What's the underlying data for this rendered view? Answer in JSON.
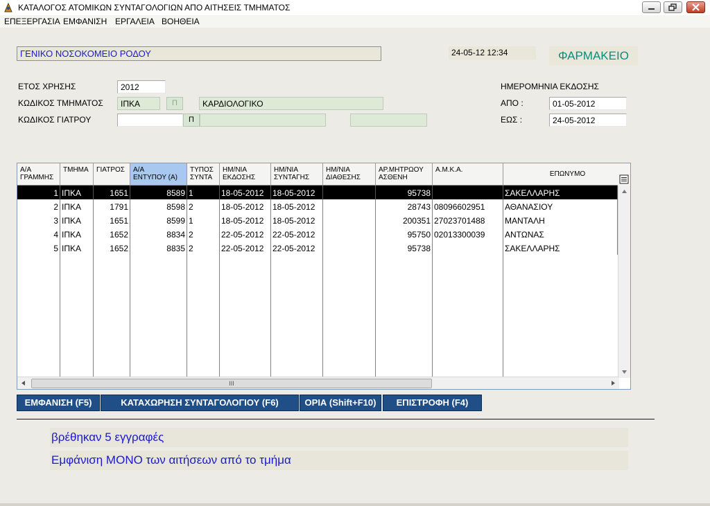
{
  "window": {
    "title": "ΚΑΤΑΛΟΓΟΣ  ΑΤΟΜΙΚΩΝ ΣΥΝΤΑΓΟΛΟΓΙΩΝ ΑΠΟ ΑΙΤΗΣΕΙΣ ΤΜΗΜΑΤΟΣ"
  },
  "menu": [
    "ΕΠΕΞΕΡΓΑΣΙΑ",
    "ΕΜΦΑΝΙΣΗ",
    "ΕΡΓΑΛΕΙΑ",
    "ΒΟΗΘΕΙΑ"
  ],
  "header": {
    "hospital": "ΓΕΝΙΚΟ ΝΟΣΟΚΟΜΕΙΟ ΡΟΔΟΥ",
    "datetime": "24-05-12 12:34",
    "pharmacy": "ΦΑΡΜΑΚΕΙΟ"
  },
  "form": {
    "year_label": "ΕΤΟΣ ΧΡΗΣΗΣ",
    "year_value": "2012",
    "dept_label": "ΚΩΔΙΚΟΣ ΤΜΗΜΑΤΟΣ",
    "dept_code": "ΙΠΚΑ",
    "dept_name": "ΚΑΡΔΙΟΛΟΓΙΚΟ",
    "doctor_label": "ΚΩΔΙΚΟΣ ΓΙΑΤΡΟΥ",
    "doctor_code": "",
    "doctor_name": "",
    "doctor_extra": "",
    "lookup_button": "Π",
    "issue_date_label": "ΗΜΕΡΟΜΗΝΙΑ ΕΚΔΟΣΗΣ",
    "from_label": "ΑΠΟ  :",
    "from_value": "01-05-2012",
    "to_label": "ΕΩΣ  :",
    "to_value": "24-05-2012"
  },
  "grid": {
    "columns": [
      "Α/Α\nΓΡΑΜΜΗΣ",
      "ΤΜΗΜΑ",
      "ΓΙΑΤΡΟΣ",
      "Α/Α\nΕΝΤΥΠΟΥ (Α)",
      "ΤΥΠΟΣ\nΣΥΝΤΑ",
      "ΗΜ/ΝΙΑ\nΕΚΔΟΣΗΣ",
      "ΗΜ/ΝΙΑ\nΣΥΝΤΑΓΗΣ",
      "ΗΜ/ΝΙΑ\nΔΙΑΘΕΣΗΣ",
      "ΑΡ.ΜΗΤΡΩΟΥ\nΑΣΘΕΝΗ",
      "Α.Μ.Κ.Α.",
      "ΕΠΩΝΥΜΟ"
    ],
    "rows": [
      [
        "1",
        "ΙΠΚΑ",
        "1651",
        "8589",
        "1",
        "18-05-2012",
        "18-05-2012",
        "",
        "95738",
        "",
        "ΣΑΚΕΛΛΑΡΗΣ"
      ],
      [
        "2",
        "ΙΠΚΑ",
        "1791",
        "8598",
        "2",
        "18-05-2012",
        "18-05-2012",
        "",
        "28743",
        "08096602951",
        "ΑΘΑΝΑΣΙΟΥ"
      ],
      [
        "3",
        "ΙΠΚΑ",
        "1651",
        "8599",
        "1",
        "18-05-2012",
        "18-05-2012",
        "",
        "200351",
        "27023701488",
        "ΜΑΝΤΑΛΗ"
      ],
      [
        "4",
        "ΙΠΚΑ",
        "1652",
        "8834",
        "2",
        "22-05-2012",
        "22-05-2012",
        "",
        "95750",
        "02013300039",
        "ΑΝΤΩΝΑΣ"
      ],
      [
        "5",
        "ΙΠΚΑ",
        "1652",
        "8835",
        "2",
        "22-05-2012",
        "22-05-2012",
        "",
        "95738",
        "",
        "ΣΑΚΕΛΛΑΡΗΣ"
      ]
    ],
    "selected_row": 0,
    "hscroll_grip": "III"
  },
  "buttons": {
    "show": "ΕΜΦΑΝΙΣΗ (F5)",
    "register": "ΚΑΤΑΧΩΡΗΣΗ ΣΥΝΤΑΓΟΛΟΓΙΟΥ (F6)",
    "limits": "ΟΡΙΑ (Shift+F10)",
    "return": "ΕΠΙΣΤΡΟΦΗ (F4)"
  },
  "status": {
    "found": "βρέθηκαν  5  εγγραφές",
    "filter": "Εμφάνιση ΜΟΝΟ των αιτήσεων από το τμήμα"
  },
  "colors": {
    "accent_button": "#1f4f86",
    "message_text": "#1a1acb",
    "pharmacy_text": "#0a8c7c",
    "hospital_text": "#1a1acb"
  },
  "icons": {
    "app": "prescription-app-icon",
    "grid_menu": "list-icon"
  }
}
